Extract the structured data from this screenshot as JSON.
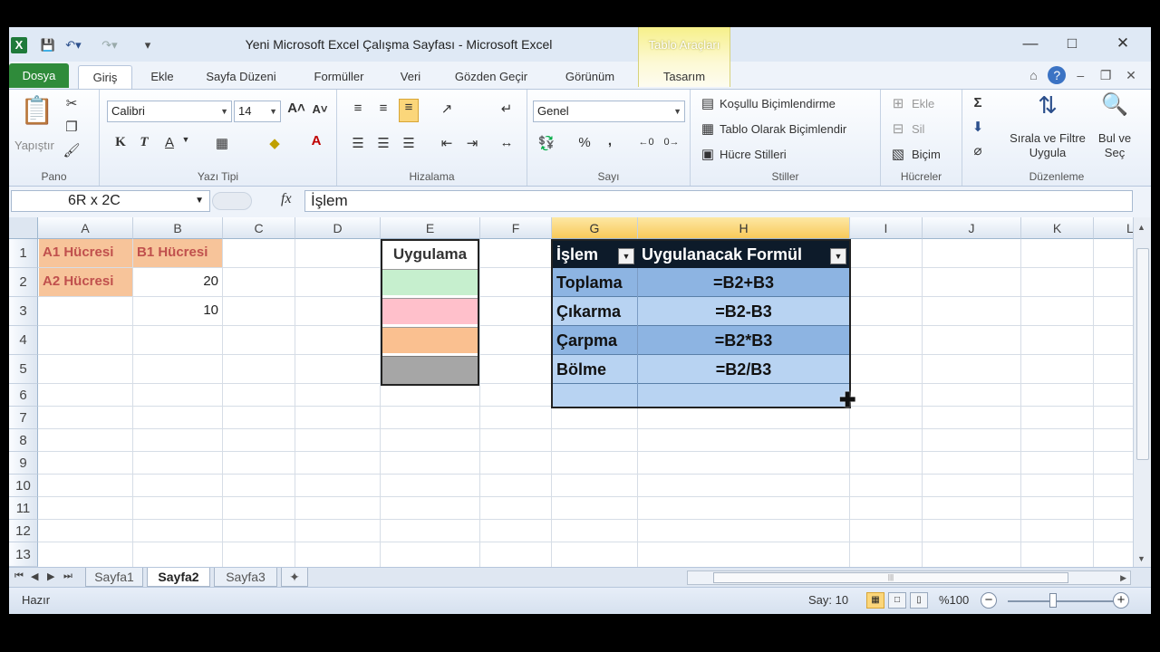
{
  "titlebar": {
    "title": "Yeni Microsoft Excel Çalışma Sayfası  -  Microsoft Excel",
    "context_tab": "Tablo Araçları"
  },
  "tabs": [
    "Dosya",
    "Giriş",
    "Ekle",
    "Sayfa Düzeni",
    "Formüller",
    "Veri",
    "Gözden Geçir",
    "Görünüm",
    "Tasarım"
  ],
  "ribbon": {
    "clipboard": {
      "paste": "Yapıştır",
      "label": "Pano"
    },
    "font": {
      "name": "Calibri",
      "size": "14",
      "label": "Yazı Tipi",
      "bold": "K",
      "italic": "T",
      "underline": "A"
    },
    "alignment": {
      "label": "Hizalama"
    },
    "number": {
      "format": "Genel",
      "percent": "%",
      "comma": ",",
      "label": "Sayı"
    },
    "styles": {
      "conditional": "Koşullu Biçimlendirme",
      "as_table": "Tablo Olarak Biçimlendir",
      "cell_styles": "Hücre Stilleri",
      "label": "Stiller"
    },
    "cells": {
      "insert": "Ekle",
      "delete": "Sil",
      "format": "Biçim",
      "label": "Hücreler"
    },
    "editing": {
      "sum": "Σ",
      "sort_line1": "Sırala ve Filtre",
      "sort_line2": "Uygula",
      "find_line1": "Bul ve",
      "find_line2": "Seç",
      "label": "Düzenleme"
    }
  },
  "formula_bar": {
    "name_box": "6R x 2C",
    "fx": "fx",
    "content": "İşlem"
  },
  "columns": [
    "A",
    "B",
    "C",
    "D",
    "E",
    "F",
    "G",
    "H",
    "I",
    "J",
    "K",
    "L"
  ],
  "rows": [
    "1",
    "2",
    "3",
    "4",
    "5",
    "6",
    "7",
    "8",
    "9",
    "10",
    "11",
    "12",
    "13"
  ],
  "cells": {
    "a1": "A1 Hücresi",
    "b1": "B1 Hücresi",
    "a2": "A2 Hücresi",
    "b2": "20",
    "b3": "10",
    "e1": "Uygulama",
    "g1": "İşlem",
    "h1": "Uygulanacak Formül",
    "g2": "Toplama",
    "h2": "=B2+B3",
    "g3": "Çıkarma",
    "h3": "=B2-B3",
    "g4": "Çarpma",
    "h4": "=B2*B3",
    "g5": "Bölme",
    "h5": "=B2/B3"
  },
  "colors": {
    "header_fill": "#f7c49a",
    "header_text": "#c0504d",
    "green": "#c6efce",
    "pink": "#ffc0cb",
    "orange": "#fac090",
    "gray": "#a6a6a6",
    "table_header": "#0d1b2a",
    "table_row_dark": "#8db4e2",
    "table_row_light": "#b8d3f2"
  },
  "sheets": [
    "Sayfa1",
    "Sayfa2",
    "Sayfa3"
  ],
  "active_sheet": "Sayfa2",
  "status": {
    "ready": "Hazır",
    "count": "Say: 10",
    "zoom": "%100"
  }
}
